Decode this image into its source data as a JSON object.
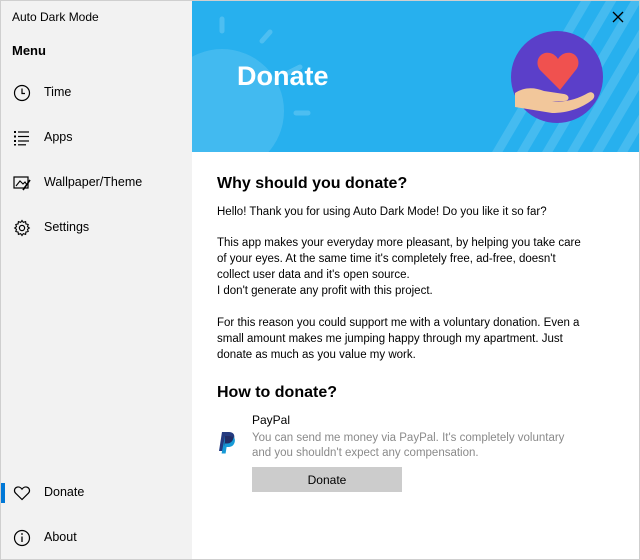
{
  "app": {
    "title": "Auto Dark Mode"
  },
  "sidebar": {
    "menu_title": "Menu",
    "items": [
      {
        "label": "Time",
        "icon": "clock-icon"
      },
      {
        "label": "Apps",
        "icon": "list-icon"
      },
      {
        "label": "Wallpaper/Theme",
        "icon": "wallpaper-icon"
      },
      {
        "label": "Settings",
        "icon": "gear-icon"
      },
      {
        "label": "Donate",
        "icon": "heart-icon",
        "active": true
      },
      {
        "label": "About",
        "icon": "info-icon"
      }
    ]
  },
  "banner": {
    "title": "Donate",
    "background_color": "#27b0ee",
    "badge_color": "#5b3fc9",
    "heart_color": "#f0514f"
  },
  "main": {
    "why_heading": "Why should you donate?",
    "para1": "Hello! Thank you for using Auto Dark Mode! Do you like it so far?",
    "para2_lines": [
      "This app makes your everyday more pleasant, by helping you take care",
      "of your eyes. At the same time it's completely free, ad-free, doesn't",
      "collect user data and it's open source.",
      "I don't generate any profit with this project."
    ],
    "para3_lines": [
      "For this reason you could support me with a voluntary donation. Even a",
      "small amount makes me jumping happy through my apartment. Just",
      "donate as much as you value my work."
    ],
    "how_heading": "How to donate?",
    "paypal": {
      "name": "PayPal",
      "description_lines": [
        "You can send me money via PayPal. It's completely voluntary",
        "and you shouldn't expect any compensation."
      ],
      "button_label": "Donate"
    }
  },
  "colors": {
    "accent": "#0078d7",
    "sidebar_bg": "#f2f2f2",
    "button_bg": "#cccccc",
    "muted_text": "#8a8a8a"
  }
}
